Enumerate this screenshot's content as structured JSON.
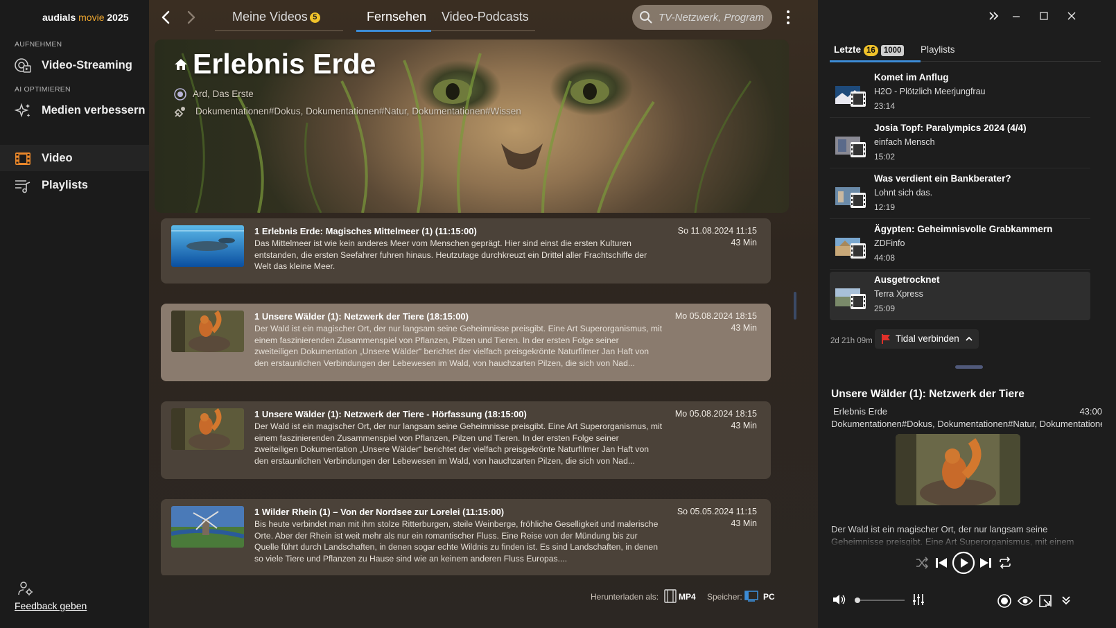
{
  "app": {
    "name_prefix": "audials ",
    "name_accent": "movie",
    "name_suffix": " 2025"
  },
  "sidebar": {
    "section_record": "AUFNEHMEN",
    "streaming_label": "Video-Streaming",
    "section_ai": "AI OPTIMIEREN",
    "enhance_label": "Medien verbessern",
    "video_label": "Video",
    "playlists_label": "Playlists",
    "feedback_label": "Feedback geben"
  },
  "tabs": {
    "my_videos": "Meine Videos",
    "my_videos_badge": "5",
    "tv": "Fernsehen",
    "podcasts": "Video-Podcasts"
  },
  "search": {
    "placeholder": "TV-Netzwerk, Program"
  },
  "hero": {
    "title": "Erlebnis Erde",
    "channel": "Ard, Das Erste",
    "categories": "Dokumentationen#Dokus, Dokumentationen#Natur, Dokumentationen#Wissen"
  },
  "episodes": [
    {
      "title": "1 Erlebnis Erde: Magisches Mittelmeer (1) (11:15:00)",
      "desc": "Das Mittelmeer ist wie kein anderes Meer vom Menschen geprägt. Hier sind einst die ersten Kulturen entstanden, die ersten Seefahrer fuhren hinaus. Heutzutage durchkreuzt ein Drittel aller Frachtschiffe der Welt das kleine Meer.",
      "date": "So 11.08.2024 11:15",
      "duration": "43  Min"
    },
    {
      "title": "1 Unsere Wälder (1): Netzwerk der Tiere (18:15:00)",
      "desc": "Der Wald ist ein magischer Ort, der nur langsam seine Geheimnisse preisgibt. Eine Art Superorganismus, mit einem faszinierenden Zusammenspiel von Pflanzen, Pilzen und Tieren. In der ersten Folge seiner zweiteiligen Dokumentation „Unsere Wälder“ berichtet der vielfach preisgekrönte Naturfilmer Jan Haft von den erstaunlichen Verbindungen der Lebewesen im Wald, von hauchzarten Pilzen, die sich von Nad...",
      "date": "Mo 05.08.2024 18:15",
      "duration": "43  Min"
    },
    {
      "title": "1 Unsere Wälder (1): Netzwerk der Tiere - Hörfassung (18:15:00)",
      "desc": "Der Wald ist ein magischer Ort, der nur langsam seine Geheimnisse preisgibt. Eine Art Superorganismus, mit einem faszinierenden Zusammenspiel von Pflanzen, Pilzen und Tieren. In der ersten Folge seiner zweiteiligen Dokumentation „Unsere Wälder“ berichtet der vielfach preisgekrönte Naturfilmer Jan Haft von den erstaunlichen Verbindungen der Lebewesen im Wald, von hauchzarten Pilzen, die sich von Nad...",
      "date": "Mo 05.08.2024 18:15",
      "duration": "43  Min"
    },
    {
      "title": "1 Wilder Rhein (1) – Von der Nordsee zur Lorelei (11:15:00)",
      "desc": "Bis heute verbindet man mit ihm stolze Ritterburgen, steile Weinberge, fröhliche Geselligkeit und malerische Orte. Aber der Rhein ist weit mehr als nur ein romantischer Fluss. Eine Reise von der Mündung bis zur Quelle führt durch Landschaften, in denen sogar echte Wildnis zu finden ist. Es sind Landschaften, in denen so viele Tiere und Pflanzen zu Hause sind wie an keinem anderen Fluss Europas....",
      "date": "So 05.05.2024 11:15",
      "duration": "43  Min"
    }
  ],
  "bottom": {
    "download_as": "Herunterladen als:",
    "format": "MP4",
    "save": "Speicher:",
    "target": "PC"
  },
  "right": {
    "tab_recent": "Letzte",
    "recent_count": "16",
    "recent_total": "1000",
    "tab_playlists": "Playlists",
    "items": [
      {
        "title": "Komet im Anflug",
        "sub": "H2O - Plötzlich Meerjungfrau",
        "dur": "23:14"
      },
      {
        "title": "Josia Topf: Paralympics 2024 (4/4)",
        "sub": "einfach Mensch",
        "dur": "15:02"
      },
      {
        "title": "Was verdient ein Bankberater?",
        "sub": "Lohnt sich das.",
        "dur": "12:19"
      },
      {
        "title": "Ägypten: Geheimnisvolle Grabkammern",
        "sub": "ZDFinfo",
        "dur": "44:08"
      },
      {
        "title": "Ausgetrocknet",
        "sub": "Terra Xpress",
        "dur": "25:09"
      }
    ],
    "time_left": "2d 21h 09m",
    "tidal_label": "Tidal verbinden",
    "now_playing": {
      "title": "Unsere Wälder (1): Netzwerk der Tiere",
      "source": "Erlebnis Erde",
      "duration": "43:00",
      "categories": "Dokumentationen#Dokus, Dokumentationen#Natur, Dokumentationen#Wissen",
      "desc": "Der Wald ist ein magischer Ort, der nur langsam seine Geheimnisse preisgibt. Eine Art Superorganismus, mit einem"
    }
  },
  "colors": {
    "accent_blue": "#3c8cd6",
    "brand_orange": "#f0a830",
    "badge_yellow": "#f0c22a",
    "tidal_red": "#e0302a"
  }
}
